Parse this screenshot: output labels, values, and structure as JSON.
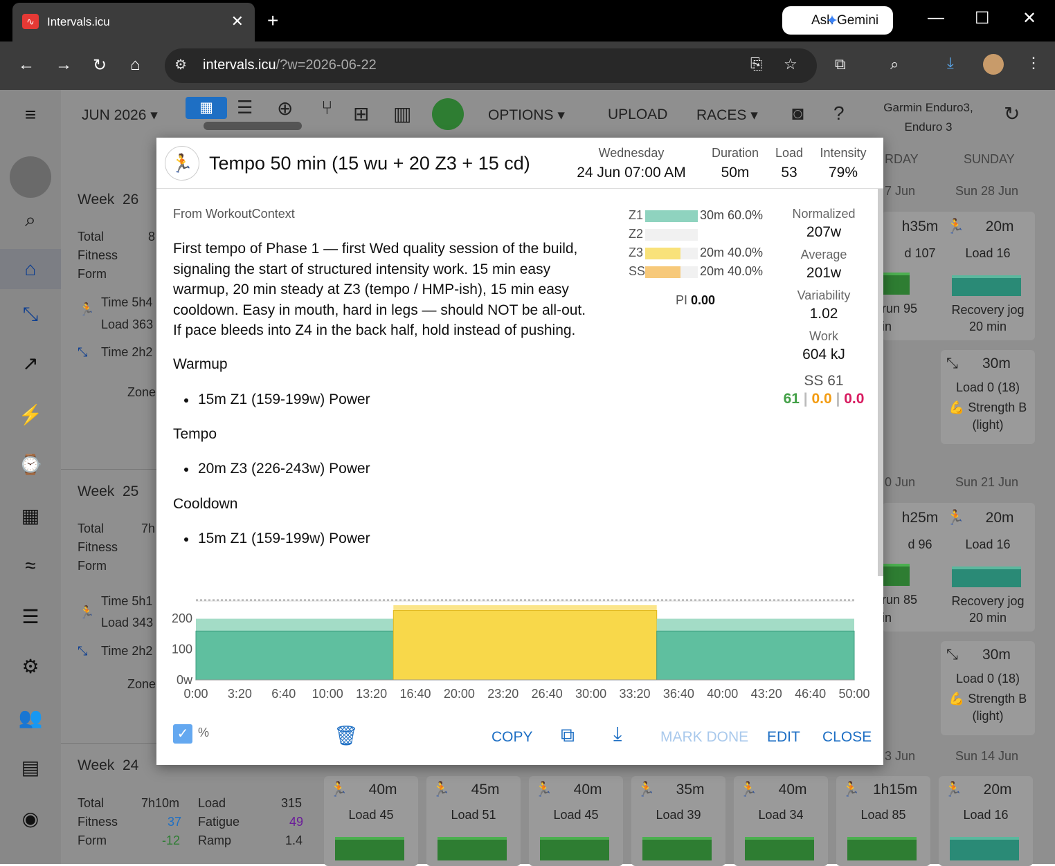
{
  "browser": {
    "tab_title": "Intervals.icu",
    "tab_close": "✕",
    "new_tab": "+",
    "gemini_label": "Ask Gemini",
    "url_host": "intervals.icu",
    "url_path": "/?w=2026-06-22"
  },
  "toolbar": {
    "month": "JUN 2026",
    "options": "OPTIONS",
    "upload": "UPLOAD",
    "races": "RACES",
    "device_line1": "Garmin Enduro3,",
    "device_line2": "Enduro 3"
  },
  "calendar": {
    "day_headers": [
      "RDAY",
      "SUNDAY"
    ],
    "weeks": [
      {
        "title": "Week",
        "num": "26",
        "total_label": "Total",
        "fitness_label": "Fitness",
        "form_label": "Form",
        "total_val": "8",
        "time_run": "Time 5h4",
        "load_run": "Load 363",
        "time_str": "Time 2h2",
        "zones": "Zone",
        "sat_date": "7 Jun",
        "sun_date": "Sun 28 Jun",
        "sat_card": {
          "dur": "h35m",
          "load": "d 107",
          "name1": "run 95",
          "name2": "in"
        },
        "sun_card": {
          "dur": "20m",
          "load": "Load 16",
          "name1": "Recovery jog",
          "name2": "20 min"
        },
        "sun_str": {
          "dur": "30m",
          "load": "Load 0 (18)",
          "name1": "Strength B",
          "name2": "(light)"
        }
      },
      {
        "title": "Week",
        "num": "25",
        "total_label": "Total",
        "fitness_label": "Fitness",
        "form_label": "Form",
        "total_val": "7h",
        "time_run": "Time 5h1",
        "load_run": "Load 343",
        "time_str": "Time 2h2",
        "zones": "Zone",
        "sat_date": "0 Jun",
        "sun_date": "Sun 21 Jun",
        "sat_card": {
          "dur": "h25m",
          "load": "d 96",
          "name1": "run 85",
          "name2": "in"
        },
        "sun_card": {
          "dur": "20m",
          "load": "Load 16",
          "name1": "Recovery jog",
          "name2": "20 min"
        },
        "sun_str": {
          "dur": "30m",
          "load": "Load 0 (18)",
          "name1": "Strength B",
          "name2": "(light)"
        }
      },
      {
        "title": "Week",
        "num": "24",
        "total_label": "Total",
        "fitness_label": "Fitness",
        "form_label": "Form",
        "total_val": "7h10m",
        "load_label": "Load",
        "load_val": "315",
        "fitness_val": "37",
        "fatigue_label": "Fatigue",
        "fatigue_val": "49",
        "form_val": "-12",
        "ramp_label": "Ramp",
        "ramp_val": "1.4",
        "sat_date": "3 Jun",
        "sun_date": "Sun 14 Jun",
        "cards": [
          {
            "dur": "40m",
            "load": "Load 45"
          },
          {
            "dur": "45m",
            "load": "Load 51"
          },
          {
            "dur": "40m",
            "load": "Load 45"
          },
          {
            "dur": "35m",
            "load": "Load 39"
          },
          {
            "dur": "40m",
            "load": "Load 34"
          },
          {
            "dur": "1h15m",
            "load": "Load 85"
          },
          {
            "dur": "20m",
            "load": "Load 16"
          }
        ]
      }
    ]
  },
  "dialog": {
    "title": "Tempo 50 min (15 wu + 20 Z3 + 15 cd)",
    "day_label": "Wednesday",
    "datetime": "24 Jun 07:00 AM",
    "duration_label": "Duration",
    "duration": "50m",
    "load_label": "Load",
    "load": "53",
    "intensity_label": "Intensity",
    "intensity": "79%",
    "from": "From WorkoutContext",
    "description": "First tempo of Phase 1 — first Wed quality session of the build, signaling the start of structured intensity work. 15 min easy warmup, 20 min steady at Z3 (tempo / HMP-ish), 15 min easy cooldown. Easy in mouth, hard in legs — should NOT be all-out. If pace bleeds into Z4 in the back half, hold instead of pushing.",
    "sections": [
      {
        "name": "Warmup",
        "step": "15m Z1 (159-199w) Power"
      },
      {
        "name": "Tempo",
        "step": "20m Z3 (226-243w) Power"
      },
      {
        "name": "Cooldown",
        "step": "15m Z1 (159-199w) Power"
      }
    ],
    "zones": [
      {
        "name": "Z1",
        "value": "30m 60.0%",
        "fraction": 0.6,
        "color": "#8fd3bf"
      },
      {
        "name": "Z2",
        "value": "",
        "fraction": 0,
        "color": "#cfeee0"
      },
      {
        "name": "Z3",
        "value": "20m 40.0%",
        "fraction": 0.4,
        "color": "#f9e27a"
      },
      {
        "name": "SS",
        "value": "20m 40.0%",
        "fraction": 0.4,
        "color": "#f7c97a"
      }
    ],
    "pi_label": "PI",
    "pi_value": "0.00",
    "stats": [
      {
        "label": "Normalized",
        "value": "207w"
      },
      {
        "label": "Average",
        "value": "201w"
      },
      {
        "label": "Variability",
        "value": "1.02"
      },
      {
        "label": "Work",
        "value": "604 kJ"
      }
    ],
    "ss_label": "SS 61",
    "ss_green": "61",
    "ss_orange": "0.0",
    "ss_red": "0.0",
    "footer": {
      "percent": "%",
      "copy": "COPY",
      "mark_done": "MARK DONE",
      "edit": "EDIT",
      "close": "CLOSE"
    }
  },
  "chart_data": {
    "type": "area",
    "ylabel": "",
    "y_ticks": [
      "200",
      "100",
      "0w"
    ],
    "x_ticks": [
      "0:00",
      "3:20",
      "6:40",
      "10:00",
      "13:20",
      "16:40",
      "20:00",
      "23:20",
      "26:40",
      "30:00",
      "33:20",
      "36:40",
      "40:00",
      "43:20",
      "46:40",
      "50:00"
    ],
    "ylim": [
      0,
      265
    ],
    "xlim_min": [
      0,
      50
    ],
    "threshold_w": 260,
    "series": [
      {
        "start_min": 0,
        "end_min": 15,
        "low_w": 159,
        "high_w": 199,
        "zone": "Z1",
        "color": "#5fbf9f"
      },
      {
        "start_min": 15,
        "end_min": 35,
        "low_w": 226,
        "high_w": 243,
        "zone": "Z3",
        "color": "#f8d84a"
      },
      {
        "start_min": 35,
        "end_min": 50,
        "low_w": 159,
        "high_w": 199,
        "zone": "Z1",
        "color": "#5fbf9f"
      }
    ]
  }
}
